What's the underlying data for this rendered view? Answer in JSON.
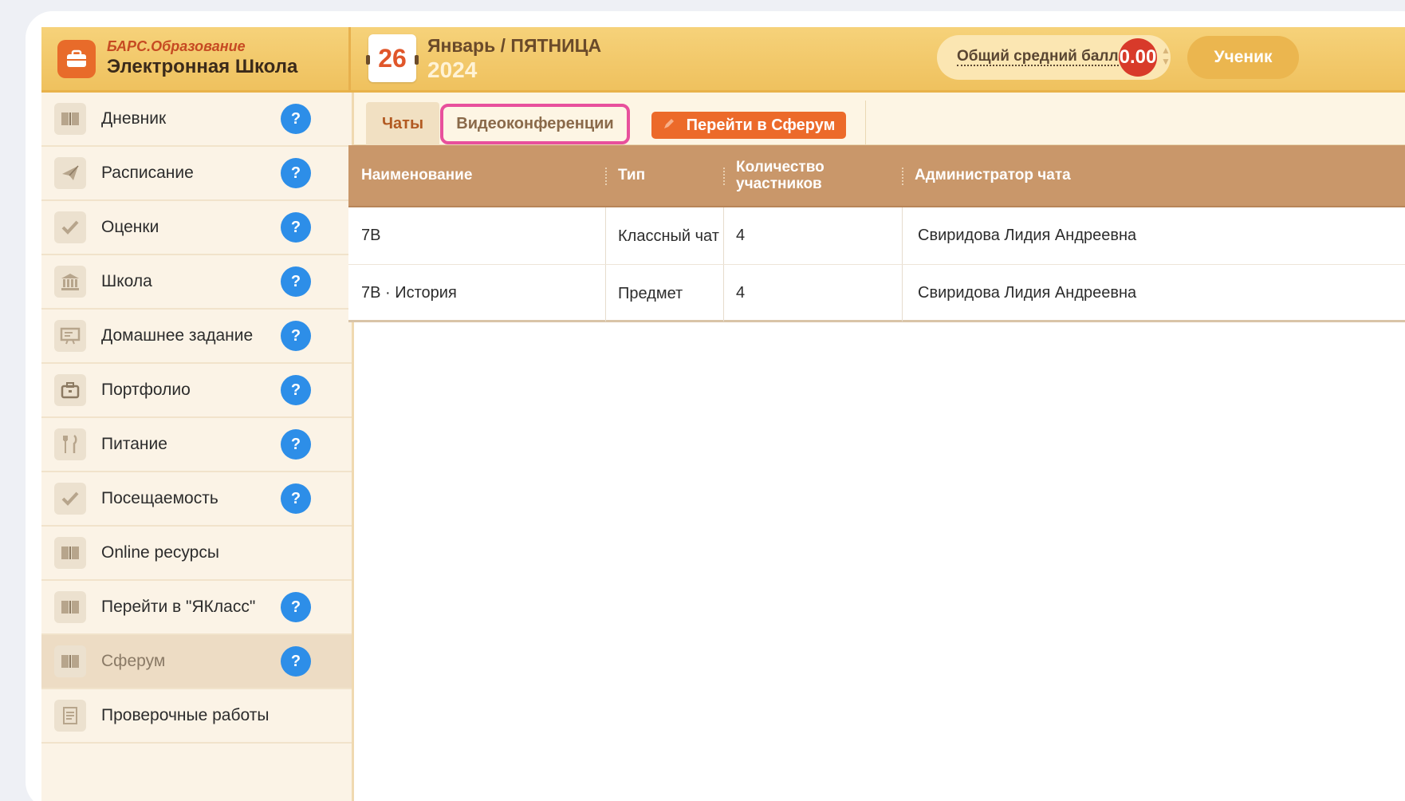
{
  "brand": {
    "line1": "БАРС.Образование",
    "line2": "Электронная Школа"
  },
  "date": {
    "day": "26",
    "month_weekday": "Январь / ПЯТНИЦА",
    "year": "2024"
  },
  "average": {
    "label": "Общий средний балл",
    "value": "0.00"
  },
  "role": "Ученик",
  "sidebar": {
    "items": [
      {
        "label": "Дневник",
        "icon": "book-icon",
        "help": "?"
      },
      {
        "label": "Расписание",
        "icon": "plane-icon",
        "help": "?"
      },
      {
        "label": "Оценки",
        "icon": "check-icon",
        "help": "?"
      },
      {
        "label": "Школа",
        "icon": "school-building-icon",
        "help": "?"
      },
      {
        "label": "Домашнее задание",
        "icon": "homework-icon",
        "help": "?"
      },
      {
        "label": "Портфолио",
        "icon": "briefcase-icon",
        "help": "?"
      },
      {
        "label": "Питание",
        "icon": "cutlery-icon",
        "help": "?"
      },
      {
        "label": "Посещаемость",
        "icon": "check-icon",
        "help": "?"
      },
      {
        "label": "Online ресурсы",
        "icon": "book-icon"
      },
      {
        "label": "Перейти в \"ЯКласс\"",
        "icon": "book-icon",
        "help": "?"
      },
      {
        "label": "Сферум",
        "icon": "book-icon",
        "help": "?",
        "active": true
      },
      {
        "label": "Проверочные работы",
        "icon": "document-icon"
      }
    ]
  },
  "tabs": {
    "chats": "Чаты",
    "video": "Видеоконференции",
    "sferum_button": "Перейти в Сферум"
  },
  "table": {
    "headers": [
      "Наименование",
      "Тип",
      "Количество участников",
      "Администратор чата"
    ],
    "rows": [
      {
        "name": "7В",
        "type": "Классный чат",
        "count": "4",
        "admin": "Свиридова Лидия Андреевна"
      },
      {
        "name": "7В · История",
        "type": "Предмет",
        "count": "4",
        "admin": "Свиридова Лидия Андреевна"
      }
    ]
  },
  "colors": {
    "header": "#f1c662",
    "accent_orange": "#ec6a2a",
    "help_blue": "#2d8ee8",
    "table_header": "#c9976a",
    "highlight_pink": "#e8509c"
  }
}
